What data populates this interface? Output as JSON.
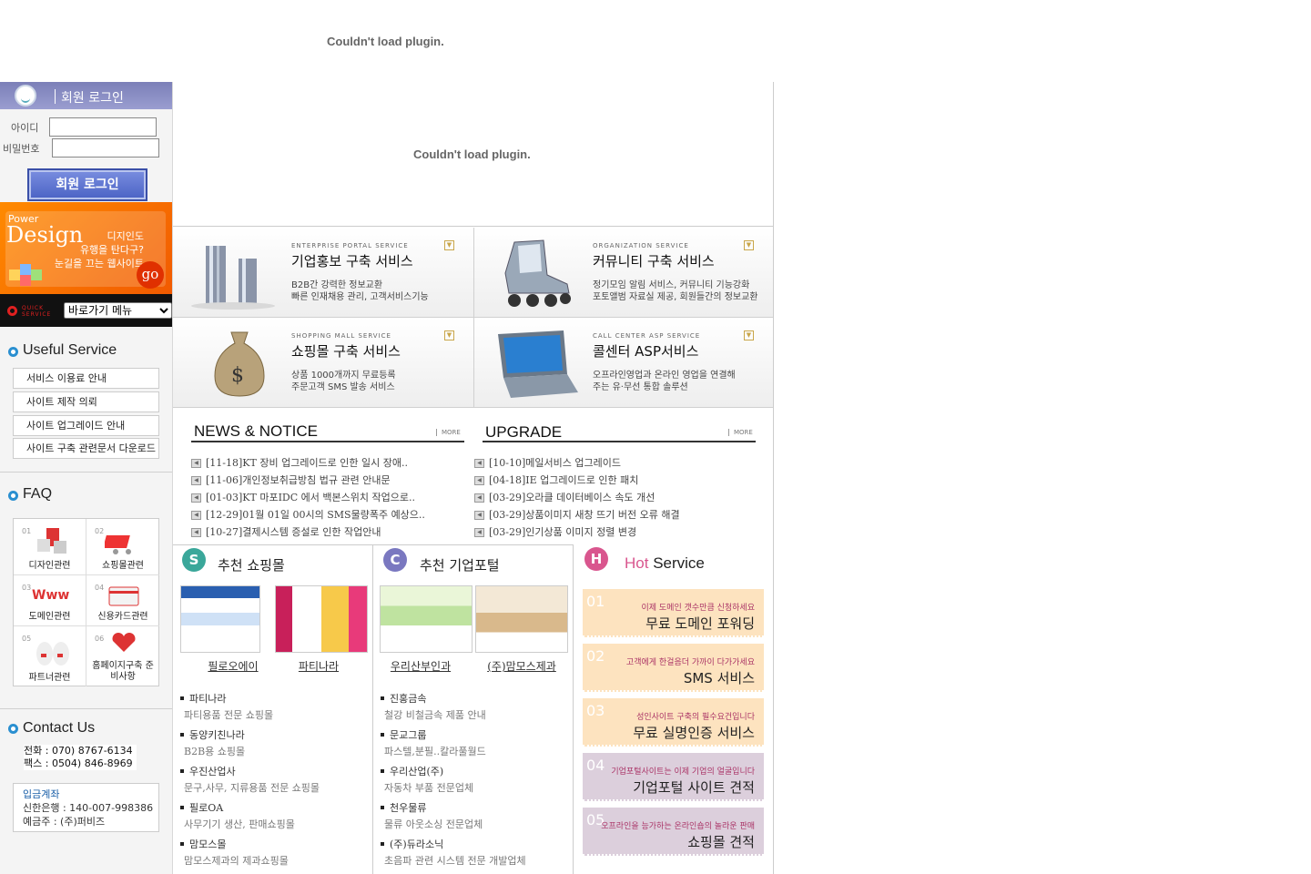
{
  "top_plugin": {
    "message": "Couldn't load plugin."
  },
  "login": {
    "title": "회원 로그인",
    "id_label": "아이디",
    "pw_label": "비밀번호",
    "button": "회원 로그인"
  },
  "banner": {
    "power": "Power",
    "design": "Design",
    "line1": "디지인도",
    "line2": "유행을 탄다구?",
    "line3": "눈길을 끄는 웹사이트",
    "go": "go"
  },
  "quick": {
    "badge": "QUICK SERVICE",
    "selected": "바로가기 메뉴"
  },
  "useful": {
    "title": "Useful Service",
    "items": [
      "서비스 이용료 안내",
      "사이트 제작 의뢰",
      "사이트 업그레이드 안내",
      "사이트 구축 관련문서 다운로드"
    ]
  },
  "faq": {
    "title": "FAQ",
    "items": [
      {
        "n": "01",
        "label": "디자인관련"
      },
      {
        "n": "02",
        "label": "쇼핑몰관련"
      },
      {
        "n": "03",
        "label": "도메인관련"
      },
      {
        "n": "04",
        "label": "신용카드관련"
      },
      {
        "n": "05",
        "label": "파트너관련"
      },
      {
        "n": "06",
        "label": "홈페이지구축 준비사항"
      }
    ]
  },
  "contact": {
    "title": "Contact Us",
    "tel": "전화 : 070) 8767-6134",
    "fax": "팩스 : 0504) 846-8969",
    "bank_title": "입금계좌",
    "bank": "신한은행 : 140-007-998386",
    "holder": "예금주 : (주)퍼비즈"
  },
  "main_plugin": {
    "message": "Couldn't load plugin."
  },
  "services": [
    {
      "en": "ENTERPRISE PORTAL SERVICE",
      "title": "기업홍보 구축 서비스",
      "d1": "B2B간 강력한 정보교환",
      "d2": "빠른 인재채용 관리, 고객서비스기능"
    },
    {
      "en": "ORGANIZATION SERVICE",
      "title": "커뮤니티 구축 서비스",
      "d1": "정기모임 알림 서비스, 커뮤니티 기능강화",
      "d2": "포토앨범 자료실 제공, 회원들간의 정보교환"
    },
    {
      "en": "SHOPPING MALL SERVICE",
      "title": "쇼핑몰 구축 서비스",
      "d1": "상품 1000개까지 무료등록",
      "d2": "주문고객 SMS 발송 서비스"
    },
    {
      "en": "CALL CENTER ASP SERVICE",
      "title": "콜센터 ASP서비스",
      "d1": "오프라인영업과 온라인 영업을 연결해",
      "d2": "주는 유·무선 통합 솔루션"
    }
  ],
  "news": {
    "title": "NEWS & NOTICE",
    "more": "MORE",
    "items": [
      "[11-18]KT 장비 업그레이드로 인한 일시 장애..",
      "[11-06]개인정보취급방침 법규 관련 안내문",
      "[01-03]KT 마포IDC 에서 백본스위치 작업으로..",
      "[12-29]01월 01일 00시의 SMS물량폭주 예상으..",
      "[10-27]결제시스템 증설로 인한 작업안내"
    ]
  },
  "upgrade": {
    "title": "UPGRADE",
    "more": "MORE",
    "items": [
      "[10-10]메일서비스 업그레이드",
      "[04-18]IE 업그레이드로 인한 패치",
      "[03-29]오라클 데이터베이스 속도 개선",
      "[03-29]상품이미지 새창 뜨기 버전 오류 해결",
      "[03-29]인기상품 이미지 정렬 변경"
    ]
  },
  "rec_shop": {
    "badge": "S",
    "title": "추천 쇼핑몰",
    "thumbs": [
      "필로오에이",
      "파티나라"
    ],
    "list": [
      {
        "name": "파티나라",
        "desc": "파티용품 전문 쇼핑몰"
      },
      {
        "name": "동양키친나라",
        "desc": "B2B용 쇼핑몰"
      },
      {
        "name": "우진산업사",
        "desc": "문구,사무, 지류용품 전문 쇼핑몰"
      },
      {
        "name": "필로OA",
        "desc": "사무기기 생산, 판매쇼핑몰"
      },
      {
        "name": "맘모스몰",
        "desc": "맘모스제과의 제과쇼핑몰"
      }
    ]
  },
  "rec_portal": {
    "badge": "C",
    "title": "추천 기업포털",
    "thumbs": [
      "우리산부인과",
      "(주)맘모스제과"
    ],
    "list": [
      {
        "name": "진홍금속",
        "desc": "철강 비철금속 제품 안내"
      },
      {
        "name": "문교그룹",
        "desc": "파스텔,분필..칼라풀월드"
      },
      {
        "name": "우리산업(주)",
        "desc": "자동차 부품 전문업체"
      },
      {
        "name": "천우물류",
        "desc": "물류 아웃소싱 전문업체"
      },
      {
        "name": "(주)듀라소닉",
        "desc": "초음파 관련 시스템 전문 개발업체"
      }
    ]
  },
  "hot": {
    "badge": "H",
    "title_hot": "Hot",
    "title_rest": " Service",
    "items": [
      {
        "n": "01",
        "s": "이제 도메인 갯수만큼 신청하세요",
        "b": "무료 도메인 포워딩",
        "color": "#fde3bf"
      },
      {
        "n": "02",
        "s": "고객에게 한걸음더 가까이 다가가세요",
        "b": "SMS 서비스",
        "color": "#fde3bf"
      },
      {
        "n": "03",
        "s": "성인사이트 구축의 필수요건입니다",
        "b": "무료 실명인증 서비스",
        "color": "#fde3bf"
      },
      {
        "n": "04",
        "s": "기업포털사이트는 이제 기업의 얼굴입니다",
        "b": "기업포털 사이트 견적",
        "color": "#dccfdc"
      },
      {
        "n": "05",
        "s": "오프라인을 능가하는 온라인숍의 놀라운 판매",
        "b": "쇼핑몰 견적",
        "color": "#dccfdc"
      }
    ]
  },
  "colors": {
    "accent": "#2a8fd0",
    "login_head": "#8a8dc4",
    "banner": "#f56a00",
    "hot_warm": "#fde3bf",
    "hot_cool": "#dccfdc"
  }
}
